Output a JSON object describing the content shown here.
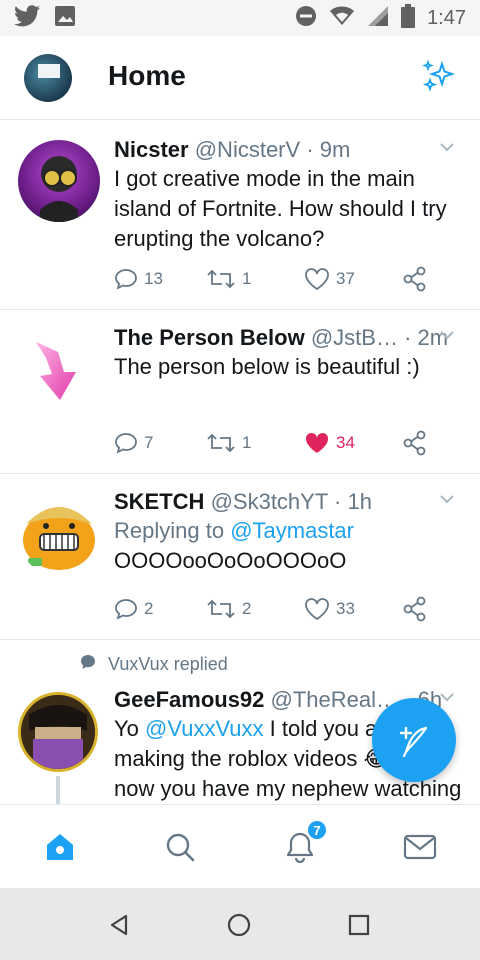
{
  "status_bar": {
    "time": "1:47",
    "icons": [
      "twitter-icon",
      "gallery-icon",
      "do-not-disturb-icon",
      "wifi-icon",
      "signal-icon",
      "battery-icon"
    ]
  },
  "header": {
    "title": "Home",
    "sparkle_icon": "sparkle-icon"
  },
  "tweets": [
    {
      "name": "Nicster",
      "handle": "@NicsterV",
      "dot": "·",
      "time": "9m",
      "text": "I got creative mode in the main island of Fortnite. How should I try erupting the volcano?",
      "replies": "13",
      "retweets": "1",
      "likes": "37",
      "liked": false
    },
    {
      "name": "The Person Below",
      "handle": "@JstB…",
      "dot": "·",
      "time": "2m",
      "text": "The person below is beautiful :)",
      "replies": "7",
      "retweets": "1",
      "likes": "34",
      "liked": true
    },
    {
      "name": "SKETCH",
      "handle": "@Sk3tchYT",
      "dot": "·",
      "time": "1h",
      "reply_prefix": "Replying to ",
      "reply_mention": "@Taymastar",
      "text": "OOOOooOoOoOOOoO",
      "replies": "2",
      "retweets": "2",
      "likes": "33",
      "liked": false
    },
    {
      "replied_label": "VuxVux replied",
      "name": "GeeFamous92",
      "handle": "@TheReal…",
      "dot": "·",
      "time": "6h",
      "text_before": "Yo ",
      "mention": "@VuxxVuxx",
      "text_line1_rest": " I told you ab",
      "text_line2": "making the roblox videos 😂",
      "text_line3": "now you have my nephew watching"
    }
  ],
  "bottom_nav": {
    "notifications_badge": "7",
    "tabs": [
      "home-icon",
      "search-icon",
      "notifications-icon",
      "messages-icon"
    ]
  },
  "colors": {
    "accent": "#1da1f2",
    "like": "#e0245e",
    "text_secondary": "#657786"
  }
}
